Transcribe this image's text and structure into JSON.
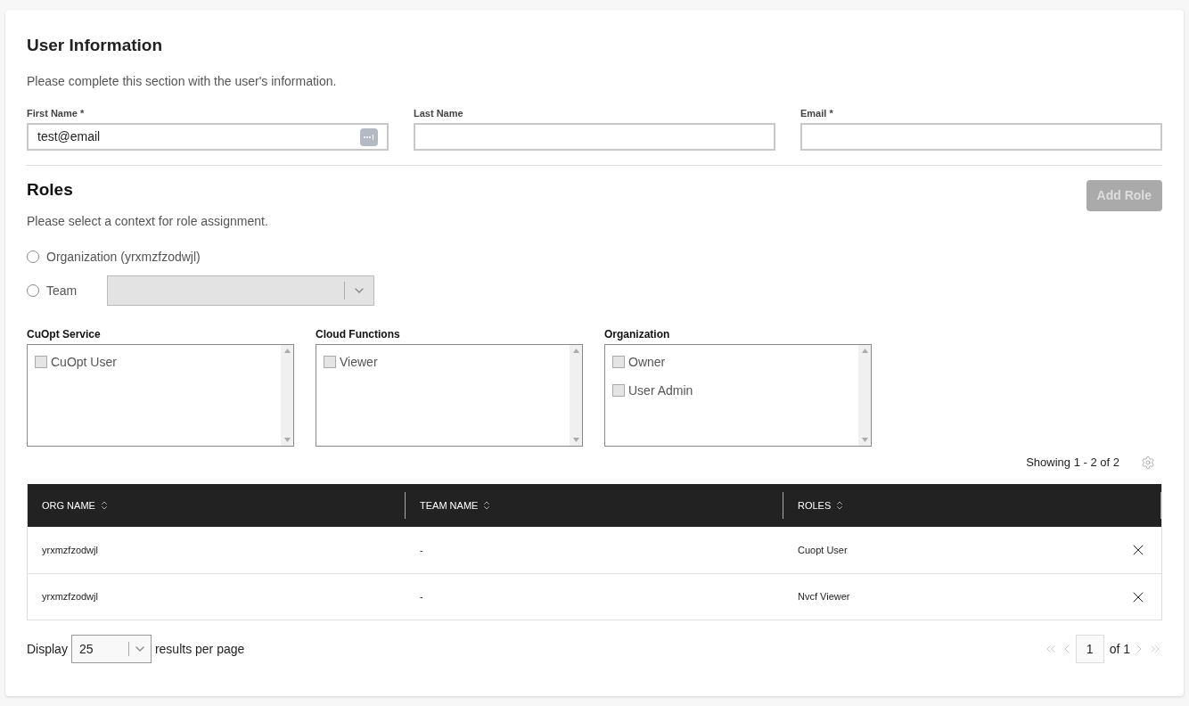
{
  "user_info": {
    "title": "User Information",
    "description": "Please complete this section with the user's information.",
    "fields": [
      {
        "label": "First Name *",
        "value": "test@email"
      },
      {
        "label": "Last Name"
      },
      {
        "label": "Email *"
      }
    ]
  },
  "roles": {
    "title": "Roles",
    "add_button": {
      "label": "Add Role",
      "disabled": true
    },
    "description": "Please select a context for role assignment.",
    "contexts": [
      {
        "kind": "plain",
        "label": "Organization (yrxmzfzodwjl)",
        "selected": false
      },
      {
        "kind": "select",
        "label": "Team",
        "selected": false,
        "disabled": true
      }
    ],
    "groups": [
      {
        "title": "CuOpt Service",
        "options": [
          {
            "label": "CuOpt User",
            "checked": false
          }
        ]
      },
      {
        "title": "Cloud Functions",
        "options": [
          {
            "label": "Viewer",
            "checked": false
          }
        ]
      },
      {
        "title": "Organization",
        "options": [
          {
            "label": "Owner",
            "checked": false
          },
          {
            "label": "User Admin",
            "checked": false
          }
        ]
      }
    ]
  },
  "table": {
    "summary": "Showing 1 - 2 of 2",
    "columns": [
      "ORG NAME",
      "TEAM NAME",
      "ROLES"
    ],
    "rows": [
      [
        "yrxmzfzodwjl",
        "-",
        "Cuopt User"
      ],
      [
        "yrxmzfzodwjl",
        "-",
        "Nvcf Viewer"
      ]
    ]
  },
  "pagination": {
    "display_label": "Display",
    "page_size": "25",
    "per_page_label": "results per page",
    "page": "1",
    "of_label": "of 1"
  }
}
